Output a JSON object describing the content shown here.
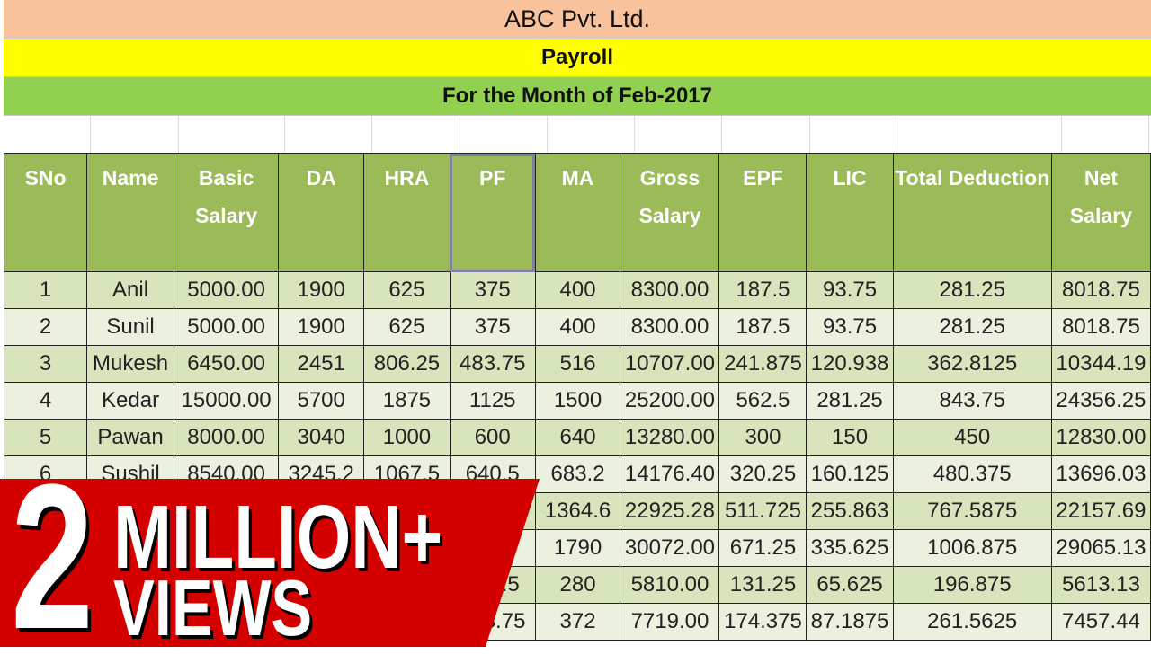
{
  "sheet": {
    "company": "ABC Pvt. Ltd.",
    "title": "Payroll",
    "period": "For the Month of Feb-2017"
  },
  "colors": {
    "company_band": "#f7c29c",
    "title_band": "#ffff00",
    "period_band": "#92d050",
    "header": "#9bbb59",
    "row_odd": "#d8e4bc",
    "row_even": "#ebf1de",
    "banner": "#d40000"
  },
  "columns": [
    "SNo",
    "Name",
    "Basic Salary",
    "DA",
    "HRA",
    "PF",
    "MA",
    "Gross Salary",
    "EPF",
    "LIC",
    "Total Deduction",
    "Net Salary"
  ],
  "selected_column": "PF",
  "rows": [
    [
      "1",
      "Anil",
      "5000.00",
      "1900",
      "625",
      "375",
      "400",
      "8300.00",
      "187.5",
      "93.75",
      "281.25",
      "8018.75"
    ],
    [
      "2",
      "Sunil",
      "5000.00",
      "1900",
      "625",
      "375",
      "400",
      "8300.00",
      "187.5",
      "93.75",
      "281.25",
      "8018.75"
    ],
    [
      "3",
      "Mukesh",
      "6450.00",
      "2451",
      "806.25",
      "483.75",
      "516",
      "10707.00",
      "241.875",
      "120.938",
      "362.8125",
      "10344.19"
    ],
    [
      "4",
      "Kedar",
      "15000.00",
      "5700",
      "1875",
      "1125",
      "1500",
      "25200.00",
      "562.5",
      "281.25",
      "843.75",
      "24356.25"
    ],
    [
      "5",
      "Pawan",
      "8000.00",
      "3040",
      "1000",
      "600",
      "640",
      "13280.00",
      "300",
      "150",
      "450",
      "12830.00"
    ],
    [
      "6",
      "Sushil",
      "8540.00",
      "3245.2",
      "1067.5",
      "640.5",
      "683.2",
      "14176.40",
      "320.25",
      "160.125",
      "480.375",
      "13696.03"
    ],
    [
      null,
      null,
      null,
      null,
      null,
      null,
      "1364.6",
      "22925.28",
      "511.725",
      "255.863",
      "767.5875",
      "22157.69"
    ],
    [
      null,
      null,
      null,
      null,
      null,
      null,
      "1790",
      "30072.00",
      "671.25",
      "335.625",
      "1006.875",
      "29065.13"
    ],
    [
      null,
      null,
      null,
      null,
      null,
      "262.5",
      "280",
      "5810.00",
      "131.25",
      "65.625",
      "196.875",
      "5613.13"
    ],
    [
      null,
      null,
      null,
      null,
      null,
      "348.75",
      "372",
      "7719.00",
      "174.375",
      "87.1875",
      "261.5625",
      "7457.44"
    ]
  ],
  "banner": {
    "number": "2",
    "line1": "MILLION+",
    "line2": "VIEWS"
  }
}
